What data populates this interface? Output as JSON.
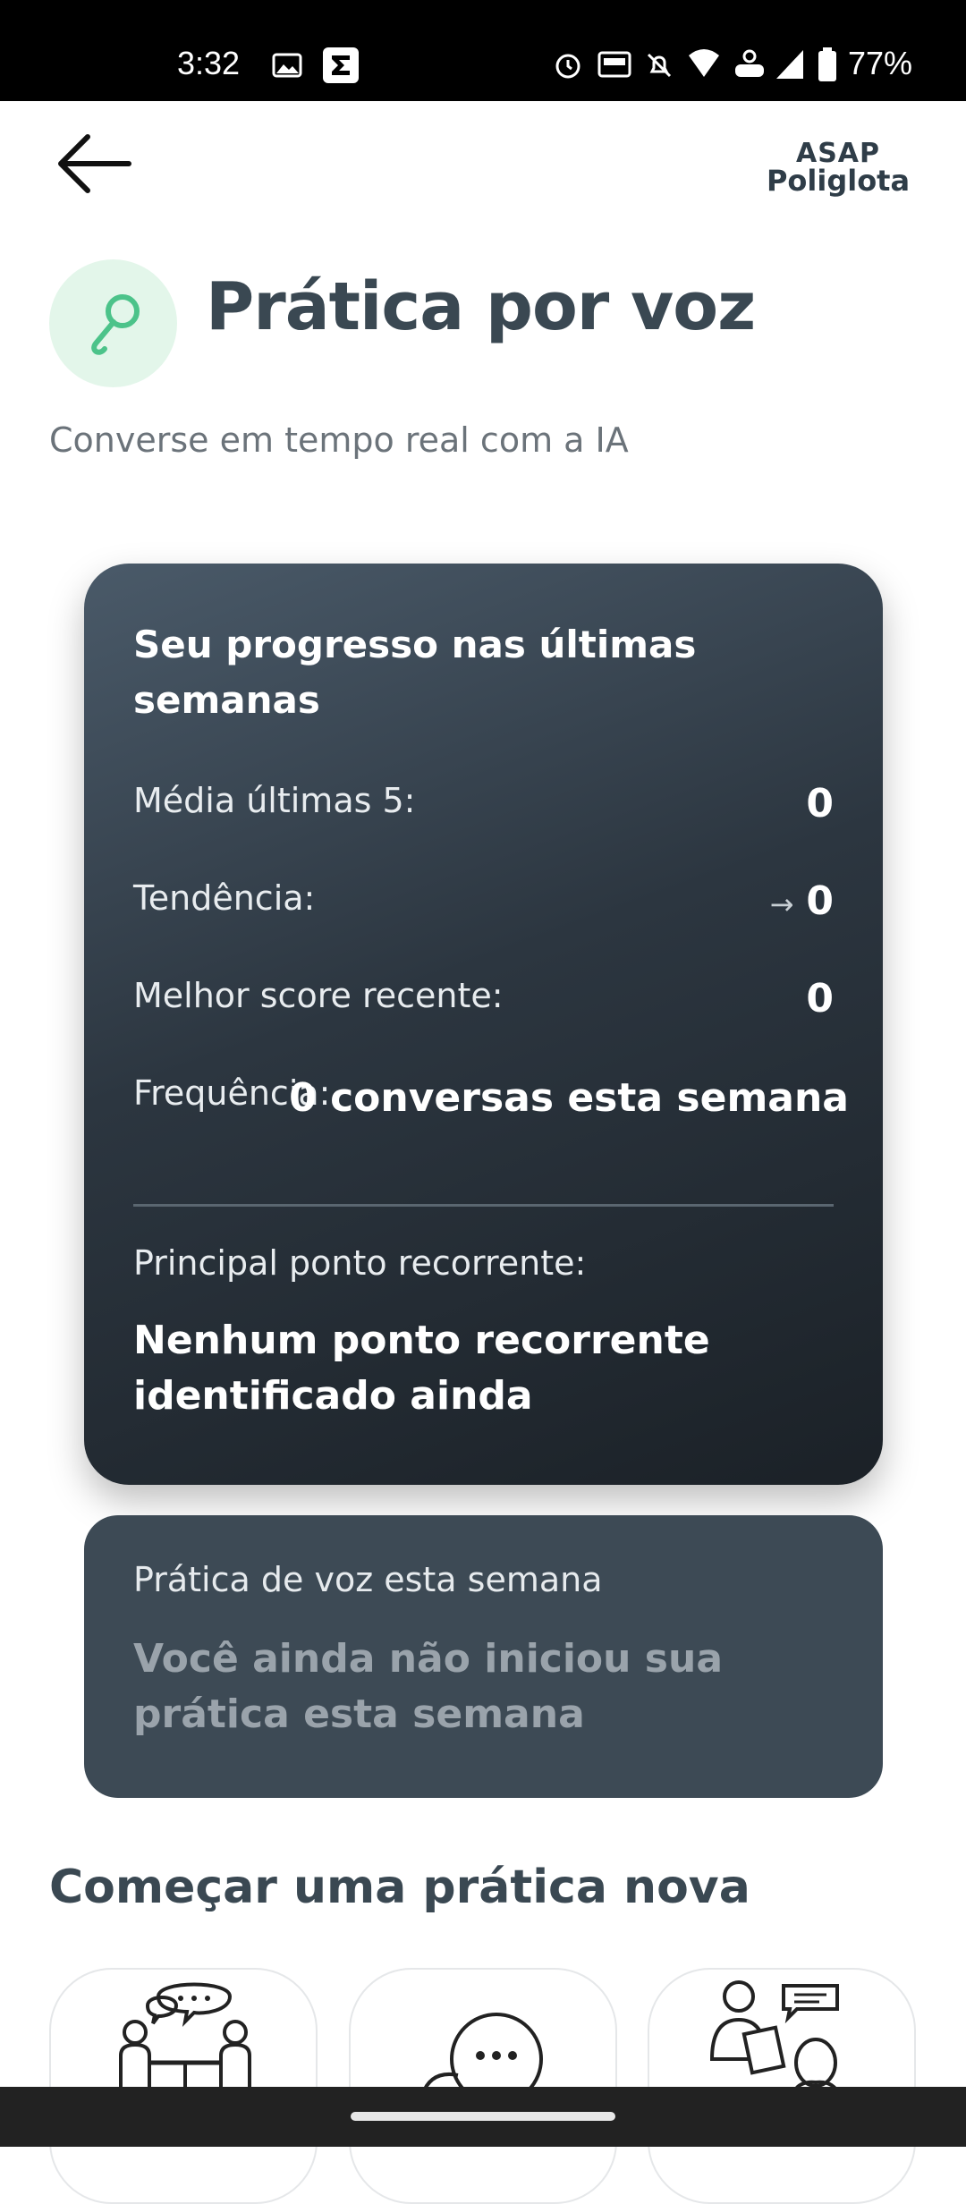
{
  "status_bar": {
    "time": "3:32",
    "battery_pct": "77%",
    "icons": [
      "image-icon",
      "sigma-app-icon",
      "alarm-icon",
      "auto-hz-icon",
      "bell-off-icon",
      "wifi-icon",
      "volte-icon",
      "signal-icon",
      "battery-icon"
    ]
  },
  "app_bar": {
    "back_icon": "arrow-left-icon",
    "logo_line1": "ASAP",
    "logo_line2": "Poliglota"
  },
  "header": {
    "icon": "microphone-icon",
    "title": "Prática por voz",
    "subtitle": "Converse em tempo real com a IA"
  },
  "progress": {
    "title": "Seu progresso nas últimas semanas",
    "rows": [
      {
        "label": "Média últimas 5:",
        "value": "0"
      },
      {
        "label": "Tendência:",
        "arrow": "→",
        "value": "0"
      },
      {
        "label": "Melhor score recente:",
        "value": "0"
      },
      {
        "label": "Frequência:",
        "value": "0 conversas esta semana"
      }
    ],
    "recurrent_label": "Principal ponto recorrente:",
    "recurrent_value": "Nenhum ponto recorrente identificado ainda"
  },
  "week": {
    "label": "Prática de voz esta semana",
    "value": "Você ainda não iniciou sua prática esta semana"
  },
  "new_practice": {
    "title": "Começar uma prática nova",
    "options": [
      {
        "icon": "conversation-table-icon"
      },
      {
        "icon": "chat-bubble-icon"
      },
      {
        "icon": "interview-icon"
      }
    ]
  },
  "colors": {
    "card_dark": "#2c3640",
    "card_slate": "#3d4a55",
    "accent_green": "#4cc38a",
    "accent_green_bg": "#e3f6ea"
  }
}
